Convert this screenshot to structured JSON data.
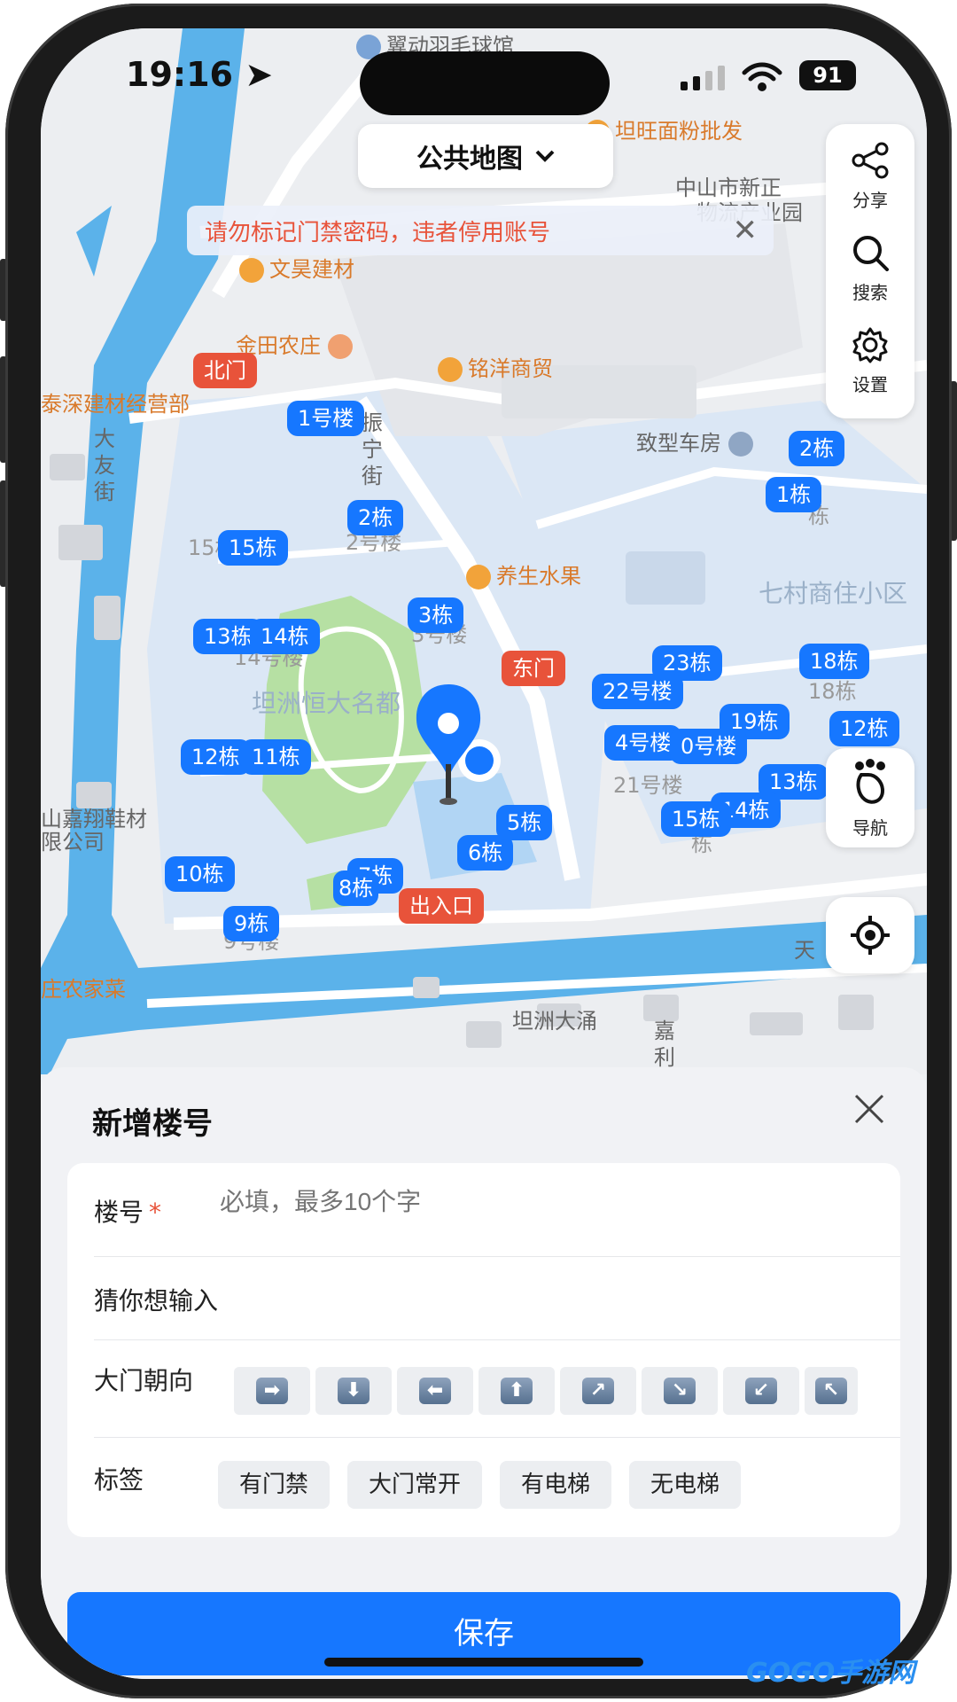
{
  "status_bar": {
    "time": "19:16",
    "battery": "91"
  },
  "map": {
    "title": "公共地图",
    "warning": "请勿标记门禁密码，违者停用账号",
    "tools": {
      "share": "分享",
      "search": "搜索",
      "settings": "设置"
    },
    "nav_label": "导航",
    "pois": [
      {
        "text": "翼动羽毛球馆"
      },
      {
        "text": "坦旺面粉批发"
      },
      {
        "text": "中山市新正"
      },
      {
        "text": "物流产业园"
      },
      {
        "text": "文昊建材"
      },
      {
        "text": "金田农庄"
      },
      {
        "text": "铭洋商贸"
      },
      {
        "text": "泰深建材经营部"
      },
      {
        "text": "致型车房"
      },
      {
        "text": "养生水果"
      },
      {
        "text": "七村商住小区"
      },
      {
        "text": "坦洲恒大名都"
      },
      {
        "text": "山嘉翔鞋材"
      },
      {
        "text": "限公司"
      },
      {
        "text": "庄农家菜"
      },
      {
        "text": "坦洲大涌"
      },
      {
        "text": "天"
      },
      {
        "text": "大友街"
      },
      {
        "text": "振宁街"
      },
      {
        "text": "嘉利"
      }
    ],
    "gates": {
      "north": "北门",
      "east": "东门",
      "exit": "出入口"
    },
    "buildings": [
      "1号楼",
      "2栋",
      "15栋",
      "3栋",
      "13栋",
      "14栋",
      "12栋",
      "11栋",
      "10栋",
      "9栋",
      "7栋",
      "8栋",
      "6栋",
      "5栋",
      "2栋",
      "1栋",
      "23栋",
      "22号楼",
      "18栋",
      "19栋",
      "4号楼",
      "0号楼",
      "12栋",
      "13栋",
      "14栋",
      "15栋"
    ],
    "faint_labels": [
      "15栋",
      "2号楼",
      "3号楼",
      "14号楼",
      "18栋",
      "21号楼",
      "栋",
      "9号楼",
      "栋"
    ]
  },
  "sheet": {
    "title": "新增楼号",
    "building_label": "楼号",
    "required_mark": "*",
    "building_placeholder": "必填，最多10个字",
    "guess_label": "猜你想输入",
    "direction_label": "大门朝向",
    "directions": [
      "right",
      "down",
      "left",
      "up",
      "up-right",
      "down-right",
      "down-left",
      "up-left"
    ],
    "tags_label": "标签",
    "tags": [
      "有门禁",
      "大门常开",
      "有电梯",
      "无电梯"
    ],
    "save_label": "保存"
  },
  "watermark": "GOGO手游网",
  "colors": {
    "accent": "#1677ff",
    "gate": "#e8533a",
    "warning": "#e8533a",
    "water": "#5bb2ea",
    "park": "#b6e0a3"
  }
}
